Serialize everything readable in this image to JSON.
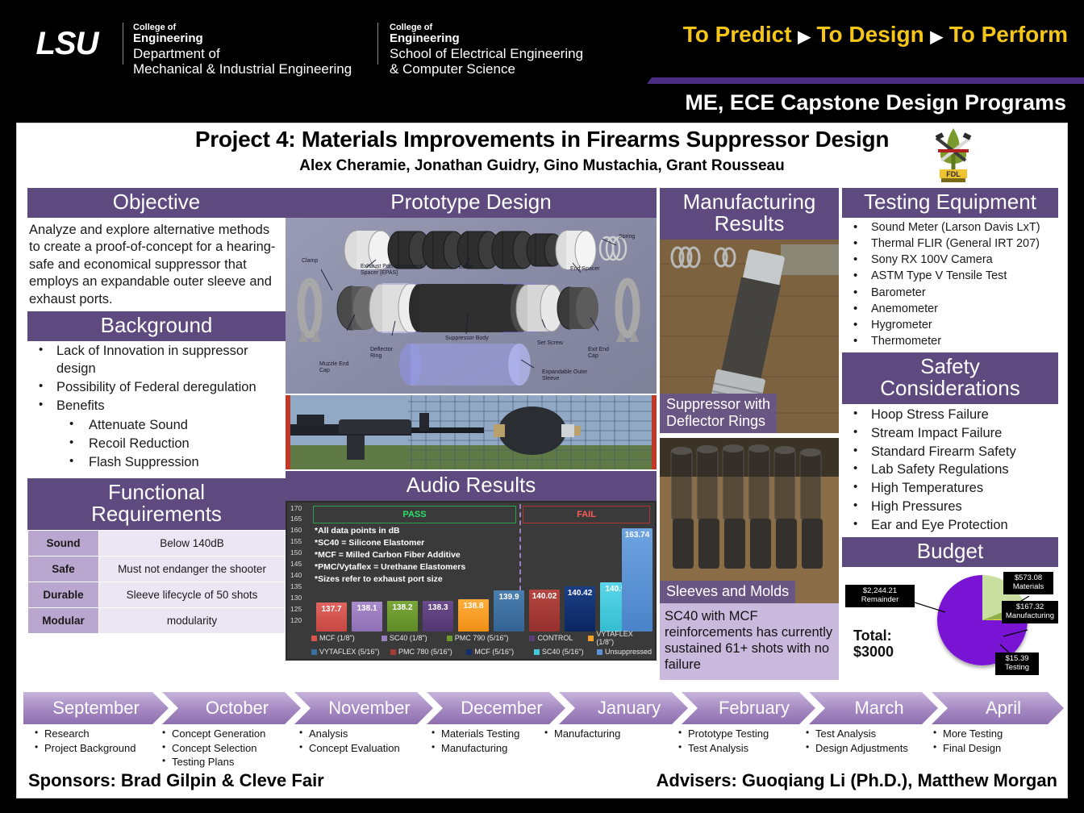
{
  "banner": {
    "logo_text": "LSU",
    "dept1": {
      "line1": "College of",
      "line2": "Engineering",
      "line3": "Department of",
      "line4": "Mechanical & Industrial Engineering"
    },
    "dept2": {
      "line1": "College of",
      "line2": "Engineering",
      "line3": "School of Electrical Engineering",
      "line4": "& Computer Science"
    },
    "tagline": {
      "a": "To Predict",
      "b": "To Design",
      "c": "To Perform",
      "arrow": "▶"
    },
    "subtitle": "ME, ECE Capstone Design Programs"
  },
  "poster": {
    "title": "Project 4: Materials Improvements in Firearms Suppressor Design",
    "authors": "Alex Cheramie, Jonathan Guidry, Gino Mustachia, Grant Rousseau",
    "logo_name": "FDL GROUP"
  },
  "objective": {
    "header": "Objective",
    "text": "Analyze and explore alternative methods to create a proof-of-concept for a hearing-safe and economical suppressor that employs an expandable outer sleeve and exhaust ports."
  },
  "background": {
    "header": "Background",
    "items": [
      "Lack of Innovation in suppressor design",
      "Possibility of Federal deregulation",
      "Benefits"
    ],
    "subitems": [
      "Attenuate Sound",
      "Recoil Reduction",
      "Flash Suppression"
    ]
  },
  "functional": {
    "header_l1": "Functional",
    "header_l2": "Requirements",
    "rows": [
      {
        "key": "Sound",
        "value": "Below 140dB"
      },
      {
        "key": "Safe",
        "value": "Must not endanger the shooter"
      },
      {
        "key": "Durable",
        "value": "Sleeve lifecycle of 50 shots"
      },
      {
        "key": "Modular",
        "value": "modularity"
      }
    ]
  },
  "prototype": {
    "header": "Prototype Design",
    "labels": [
      "Clamp",
      "Exhaust Port Adjustment Spacer [EPAS]",
      "Baffle",
      "Spring",
      "End Spacer",
      "Muzzle End Cap",
      "Deflector Ring",
      "Suppressor Body",
      "Set Screw",
      "Exit End Cap",
      "Expandable Outer Sleeve"
    ]
  },
  "audio": {
    "header": "Audio Results",
    "notes": [
      "*All data points in dB",
      "*SC40 = Silicone Elastomer",
      "*MCF = Milled Carbon Fiber Additive",
      "*PMC/Vytaflex = Urethane Elastomers",
      "*Sizes refer to exhaust port size"
    ],
    "pass_label": "PASS",
    "fail_label": "FAIL"
  },
  "chart_data": {
    "type": "bar",
    "title": "Audio Results",
    "ylabel": "dB",
    "ylim": [
      120,
      170
    ],
    "yticks": [
      120,
      125,
      130,
      135,
      140,
      145,
      150,
      155,
      160,
      165,
      170
    ],
    "grid": true,
    "legend_position": "bottom",
    "categories": [
      "MCF (1/8\")",
      "SC40 (1/8\")",
      "PMC 790 (5/16\")",
      "CONTROL",
      "VYTAFLEX (1/8\")",
      "VYTAFLEX (5/16\")",
      "PMC 780 (5/16\")",
      "MCF (5/16\")",
      "SC40 (5/16\")",
      "Unsuppressed"
    ],
    "values": [
      137.7,
      138.1,
      138.2,
      138.3,
      138.8,
      139.9,
      140.02,
      140.42,
      140.9,
      163.74
    ],
    "colors": [
      "#d9534f",
      "#9b7fc0",
      "#6d9a2e",
      "#5c3e7a",
      "#f5a028",
      "#3a6f9f",
      "#a33b35",
      "#12306e",
      "#45c8dc",
      "#5b93d6"
    ],
    "regions": [
      {
        "label": "PASS",
        "members": [
          "MCF (1/8\")",
          "SC40 (1/8\")",
          "PMC 790 (5/16\")",
          "CONTROL",
          "VYTAFLEX (1/8\")",
          "VYTAFLEX (5/16\")"
        ],
        "color": "#2ee06a"
      },
      {
        "label": "FAIL",
        "members": [
          "PMC 780 (5/16\")",
          "MCF (5/16\")",
          "SC40 (5/16\")",
          "Unsuppressed"
        ],
        "color": "#ff5b5b"
      }
    ],
    "annotations": [
      "*All data points in dB",
      "*SC40 = Silicone Elastomer",
      "*MCF = Milled Carbon Fiber Additive",
      "*PMC/Vytaflex = Urethane Elastomers",
      "*Sizes refer to exhaust port size"
    ]
  },
  "manufacturing": {
    "header_l1": "Manufacturing",
    "header_l2": "Results",
    "caption1_l1": "Suppressor with",
    "caption1_l2": "Deflector Rings",
    "caption2": "Sleeves and Molds",
    "note": "SC40 with MCF reinforcements has currently sustained 61+ shots with no failure"
  },
  "testing": {
    "header": "Testing Equipment",
    "items": [
      "Sound Meter (Larson Davis LxT)",
      "Thermal FLIR (General IRT 207)",
      "Sony RX 100V Camera",
      "ASTM Type V Tensile Test",
      "Barometer",
      "Anemometer",
      "Hygrometer",
      "Thermometer"
    ]
  },
  "safety": {
    "header_l1": "Safety",
    "header_l2": "Considerations",
    "items": [
      "Hoop Stress Failure",
      "Stream Impact Failure",
      "Standard Firearm Safety",
      "Lab Safety Regulations",
      "High Temperatures",
      "High Pressures",
      "Ear and Eye Protection"
    ]
  },
  "budget": {
    "header": "Budget",
    "total_l1": "Total:",
    "total_l2": "$3000",
    "slices": [
      {
        "amount": "$2,244.21",
        "name": "Remainder",
        "value": 2244.21,
        "color": "#7a14d4"
      },
      {
        "amount": "$573.08",
        "name": "Materials",
        "value": 573.08,
        "color": "#c9dfa0"
      },
      {
        "amount": "$167.32",
        "name": "Manufacturing",
        "value": 167.32,
        "color": "#8fb04a"
      },
      {
        "amount": "$15.39",
        "name": "Testing",
        "value": 15.39,
        "color": "#f2e63a"
      }
    ]
  },
  "timeline": {
    "months": [
      {
        "name": "September",
        "items": [
          "Research",
          "Project Background"
        ]
      },
      {
        "name": "October",
        "items": [
          "Concept Generation",
          "Concept Selection",
          "Testing Plans"
        ]
      },
      {
        "name": "November",
        "items": [
          "Analysis",
          "Concept Evaluation"
        ]
      },
      {
        "name": "December",
        "items": [
          "Materials Testing",
          "Manufacturing"
        ]
      },
      {
        "name": "January",
        "items": [
          "Manufacturing"
        ]
      },
      {
        "name": "February",
        "items": [
          "Prototype Testing",
          "Test Analysis"
        ]
      },
      {
        "name": "March",
        "items": [
          "Test Analysis",
          "Design Adjustments"
        ]
      },
      {
        "name": "April",
        "items": [
          "More Testing",
          "Final Design"
        ]
      }
    ]
  },
  "footer": {
    "sponsors": "Sponsors: Brad Gilpin & Cleve Fair",
    "advisers": "Advisers: Guoqiang Li (Ph.D.), Matthew Morgan"
  }
}
